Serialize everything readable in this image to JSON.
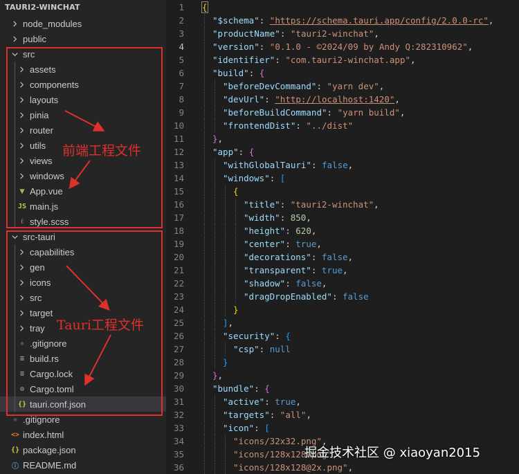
{
  "explorer": {
    "title": "TAURI2-WINCHAT",
    "rows": [
      {
        "label": "node_modules",
        "type": "folder",
        "depth": 0,
        "open": false
      },
      {
        "label": "public",
        "type": "folder",
        "depth": 0,
        "open": false
      },
      {
        "label": "src",
        "type": "folder",
        "depth": 0,
        "open": true
      },
      {
        "label": "assets",
        "type": "folder",
        "depth": 1,
        "open": false
      },
      {
        "label": "components",
        "type": "folder",
        "depth": 1,
        "open": false
      },
      {
        "label": "layouts",
        "type": "folder",
        "depth": 1,
        "open": false
      },
      {
        "label": "pinia",
        "type": "folder",
        "depth": 1,
        "open": false
      },
      {
        "label": "router",
        "type": "folder",
        "depth": 1,
        "open": false
      },
      {
        "label": "utils",
        "type": "folder",
        "depth": 1,
        "open": false
      },
      {
        "label": "views",
        "type": "folder",
        "depth": 1,
        "open": false
      },
      {
        "label": "windows",
        "type": "folder",
        "depth": 1,
        "open": false
      },
      {
        "label": "App.vue",
        "type": "vue",
        "depth": 1
      },
      {
        "label": "main.js",
        "type": "js",
        "depth": 1
      },
      {
        "label": "style.scss",
        "type": "scss",
        "depth": 1
      },
      {
        "label": "src-tauri",
        "type": "folder",
        "depth": 0,
        "open": true
      },
      {
        "label": "capabilities",
        "type": "folder",
        "depth": 1,
        "open": false
      },
      {
        "label": "gen",
        "type": "folder",
        "depth": 1,
        "open": false
      },
      {
        "label": "icons",
        "type": "folder",
        "depth": 1,
        "open": false
      },
      {
        "label": "src",
        "type": "folder",
        "depth": 1,
        "open": false
      },
      {
        "label": "target",
        "type": "folder",
        "depth": 1,
        "open": false
      },
      {
        "label": "tray",
        "type": "folder",
        "depth": 1,
        "open": false
      },
      {
        "label": ".gitignore",
        "type": "git",
        "depth": 1
      },
      {
        "label": "build.rs",
        "type": "rs",
        "depth": 1
      },
      {
        "label": "Cargo.lock",
        "type": "lock",
        "depth": 1
      },
      {
        "label": "Cargo.toml",
        "type": "toml",
        "depth": 1
      },
      {
        "label": "tauri.conf.json",
        "type": "json",
        "depth": 1,
        "selected": true
      },
      {
        "label": ".gitignore",
        "type": "git",
        "depth": 0
      },
      {
        "label": "index.html",
        "type": "html",
        "depth": 0
      },
      {
        "label": "package.json",
        "type": "json",
        "depth": 0
      },
      {
        "label": "README.md",
        "type": "md",
        "depth": 0
      }
    ]
  },
  "editor": {
    "current_line": 4,
    "lines": [
      {
        "n": "1",
        "indent": 0,
        "tokens": [
          {
            "t": "{",
            "c": "bracket-gold cursorbox"
          }
        ]
      },
      {
        "n": "2",
        "indent": 1,
        "tokens": [
          {
            "t": "\"$schema\"",
            "c": "k"
          },
          {
            "t": ": ",
            "c": "p"
          },
          {
            "t": "\"https://schema.tauri.app/config/2.0.0-rc\"",
            "c": "u"
          },
          {
            "t": ",",
            "c": "p"
          }
        ]
      },
      {
        "n": "3",
        "indent": 1,
        "tokens": [
          {
            "t": "\"productName\"",
            "c": "k"
          },
          {
            "t": ": ",
            "c": "p"
          },
          {
            "t": "\"tauri2-winchat\"",
            "c": "s"
          },
          {
            "t": ",",
            "c": "p"
          }
        ]
      },
      {
        "n": "4",
        "indent": 1,
        "tokens": [
          {
            "t": "\"version\"",
            "c": "k"
          },
          {
            "t": ": ",
            "c": "p"
          },
          {
            "t": "\"0.1.0 - ©2024/09 by Andy Q:282310962\"",
            "c": "s"
          },
          {
            "t": ",",
            "c": "p"
          }
        ]
      },
      {
        "n": "5",
        "indent": 1,
        "tokens": [
          {
            "t": "\"identifier\"",
            "c": "k"
          },
          {
            "t": ": ",
            "c": "p"
          },
          {
            "t": "\"com.tauri2-winchat.app\"",
            "c": "s"
          },
          {
            "t": ",",
            "c": "p"
          }
        ]
      },
      {
        "n": "6",
        "indent": 1,
        "tokens": [
          {
            "t": "\"build\"",
            "c": "k"
          },
          {
            "t": ": ",
            "c": "p"
          },
          {
            "t": "{",
            "c": "bracket-violet"
          }
        ]
      },
      {
        "n": "7",
        "indent": 2,
        "tokens": [
          {
            "t": "\"beforeDevCommand\"",
            "c": "k"
          },
          {
            "t": ": ",
            "c": "p"
          },
          {
            "t": "\"yarn dev\"",
            "c": "s"
          },
          {
            "t": ",",
            "c": "p"
          }
        ]
      },
      {
        "n": "8",
        "indent": 2,
        "tokens": [
          {
            "t": "\"devUrl\"",
            "c": "k"
          },
          {
            "t": ": ",
            "c": "p"
          },
          {
            "t": "\"http://localhost:1420\"",
            "c": "u"
          },
          {
            "t": ",",
            "c": "p"
          }
        ]
      },
      {
        "n": "9",
        "indent": 2,
        "tokens": [
          {
            "t": "\"beforeBuildCommand\"",
            "c": "k"
          },
          {
            "t": ": ",
            "c": "p"
          },
          {
            "t": "\"yarn build\"",
            "c": "s"
          },
          {
            "t": ",",
            "c": "p"
          }
        ]
      },
      {
        "n": "10",
        "indent": 2,
        "tokens": [
          {
            "t": "\"frontendDist\"",
            "c": "k"
          },
          {
            "t": ": ",
            "c": "p"
          },
          {
            "t": "\"../dist\"",
            "c": "s"
          }
        ]
      },
      {
        "n": "11",
        "indent": 1,
        "tokens": [
          {
            "t": "}",
            "c": "bracket-violet"
          },
          {
            "t": ",",
            "c": "p"
          }
        ]
      },
      {
        "n": "12",
        "indent": 1,
        "tokens": [
          {
            "t": "\"app\"",
            "c": "k"
          },
          {
            "t": ": ",
            "c": "p"
          },
          {
            "t": "{",
            "c": "bracket-violet"
          }
        ]
      },
      {
        "n": "13",
        "indent": 2,
        "tokens": [
          {
            "t": "\"withGlobalTauri\"",
            "c": "k"
          },
          {
            "t": ": ",
            "c": "p"
          },
          {
            "t": "false",
            "c": "b"
          },
          {
            "t": ",",
            "c": "p"
          }
        ]
      },
      {
        "n": "14",
        "indent": 2,
        "tokens": [
          {
            "t": "\"windows\"",
            "c": "k"
          },
          {
            "t": ": ",
            "c": "p"
          },
          {
            "t": "[",
            "c": "bracket-blue"
          }
        ]
      },
      {
        "n": "15",
        "indent": 3,
        "tokens": [
          {
            "t": "{",
            "c": "bracket-gold"
          }
        ]
      },
      {
        "n": "16",
        "indent": 4,
        "tokens": [
          {
            "t": "\"title\"",
            "c": "k"
          },
          {
            "t": ": ",
            "c": "p"
          },
          {
            "t": "\"tauri2-winchat\"",
            "c": "s"
          },
          {
            "t": ",",
            "c": "p"
          }
        ]
      },
      {
        "n": "17",
        "indent": 4,
        "tokens": [
          {
            "t": "\"width\"",
            "c": "k"
          },
          {
            "t": ": ",
            "c": "p"
          },
          {
            "t": "850",
            "c": "n"
          },
          {
            "t": ",",
            "c": "p"
          }
        ]
      },
      {
        "n": "18",
        "indent": 4,
        "tokens": [
          {
            "t": "\"height\"",
            "c": "k"
          },
          {
            "t": ": ",
            "c": "p"
          },
          {
            "t": "620",
            "c": "n"
          },
          {
            "t": ",",
            "c": "p"
          }
        ]
      },
      {
        "n": "19",
        "indent": 4,
        "tokens": [
          {
            "t": "\"center\"",
            "c": "k"
          },
          {
            "t": ": ",
            "c": "p"
          },
          {
            "t": "true",
            "c": "b"
          },
          {
            "t": ",",
            "c": "p"
          }
        ]
      },
      {
        "n": "20",
        "indent": 4,
        "tokens": [
          {
            "t": "\"decorations\"",
            "c": "k"
          },
          {
            "t": ": ",
            "c": "p"
          },
          {
            "t": "false",
            "c": "b"
          },
          {
            "t": ",",
            "c": "p"
          }
        ]
      },
      {
        "n": "21",
        "indent": 4,
        "tokens": [
          {
            "t": "\"transparent\"",
            "c": "k"
          },
          {
            "t": ": ",
            "c": "p"
          },
          {
            "t": "true",
            "c": "b"
          },
          {
            "t": ",",
            "c": "p"
          }
        ]
      },
      {
        "n": "22",
        "indent": 4,
        "tokens": [
          {
            "t": "\"shadow\"",
            "c": "k"
          },
          {
            "t": ": ",
            "c": "p"
          },
          {
            "t": "false",
            "c": "b"
          },
          {
            "t": ",",
            "c": "p"
          }
        ]
      },
      {
        "n": "23",
        "indent": 4,
        "tokens": [
          {
            "t": "\"dragDropEnabled\"",
            "c": "k"
          },
          {
            "t": ": ",
            "c": "p"
          },
          {
            "t": "false",
            "c": "b"
          }
        ]
      },
      {
        "n": "24",
        "indent": 3,
        "tokens": [
          {
            "t": "}",
            "c": "bracket-gold"
          }
        ]
      },
      {
        "n": "25",
        "indent": 2,
        "tokens": [
          {
            "t": "]",
            "c": "bracket-blue"
          },
          {
            "t": ",",
            "c": "p"
          }
        ]
      },
      {
        "n": "26",
        "indent": 2,
        "tokens": [
          {
            "t": "\"security\"",
            "c": "k"
          },
          {
            "t": ": ",
            "c": "p"
          },
          {
            "t": "{",
            "c": "bracket-blue"
          }
        ]
      },
      {
        "n": "27",
        "indent": 3,
        "tokens": [
          {
            "t": "\"csp\"",
            "c": "k"
          },
          {
            "t": ": ",
            "c": "p"
          },
          {
            "t": "null",
            "c": "b"
          }
        ]
      },
      {
        "n": "28",
        "indent": 2,
        "tokens": [
          {
            "t": "}",
            "c": "bracket-blue"
          }
        ]
      },
      {
        "n": "29",
        "indent": 1,
        "tokens": [
          {
            "t": "}",
            "c": "bracket-violet"
          },
          {
            "t": ",",
            "c": "p"
          }
        ]
      },
      {
        "n": "30",
        "indent": 1,
        "tokens": [
          {
            "t": "\"bundle\"",
            "c": "k"
          },
          {
            "t": ": ",
            "c": "p"
          },
          {
            "t": "{",
            "c": "bracket-violet"
          }
        ]
      },
      {
        "n": "31",
        "indent": 2,
        "tokens": [
          {
            "t": "\"active\"",
            "c": "k"
          },
          {
            "t": ": ",
            "c": "p"
          },
          {
            "t": "true",
            "c": "b"
          },
          {
            "t": ",",
            "c": "p"
          }
        ]
      },
      {
        "n": "32",
        "indent": 2,
        "tokens": [
          {
            "t": "\"targets\"",
            "c": "k"
          },
          {
            "t": ": ",
            "c": "p"
          },
          {
            "t": "\"all\"",
            "c": "s"
          },
          {
            "t": ",",
            "c": "p"
          }
        ]
      },
      {
        "n": "33",
        "indent": 2,
        "tokens": [
          {
            "t": "\"icon\"",
            "c": "k"
          },
          {
            "t": ": ",
            "c": "p"
          },
          {
            "t": "[",
            "c": "bracket-blue"
          }
        ]
      },
      {
        "n": "34",
        "indent": 3,
        "tokens": [
          {
            "t": "\"icons/32x32.png\"",
            "c": "s"
          },
          {
            "t": ",",
            "c": "p"
          }
        ]
      },
      {
        "n": "35",
        "indent": 3,
        "tokens": [
          {
            "t": "\"icons/128x128.png\"",
            "c": "s"
          },
          {
            "t": ",",
            "c": "p"
          }
        ]
      },
      {
        "n": "36",
        "indent": 3,
        "tokens": [
          {
            "t": "\"icons/128x128@2x.png\"",
            "c": "s"
          },
          {
            "t": ",",
            "c": "p"
          }
        ]
      }
    ]
  },
  "annotations": {
    "frontend_label": "前端工程文件",
    "tauri_label": "Tauri工程文件"
  },
  "watermark": "掘金技术社区 @ xiaoyan2015",
  "colors": {
    "annotation": "#e0302c",
    "sidebar_bg": "#252526",
    "editor_bg": "#1e1e1e",
    "selection": "#37373d"
  }
}
